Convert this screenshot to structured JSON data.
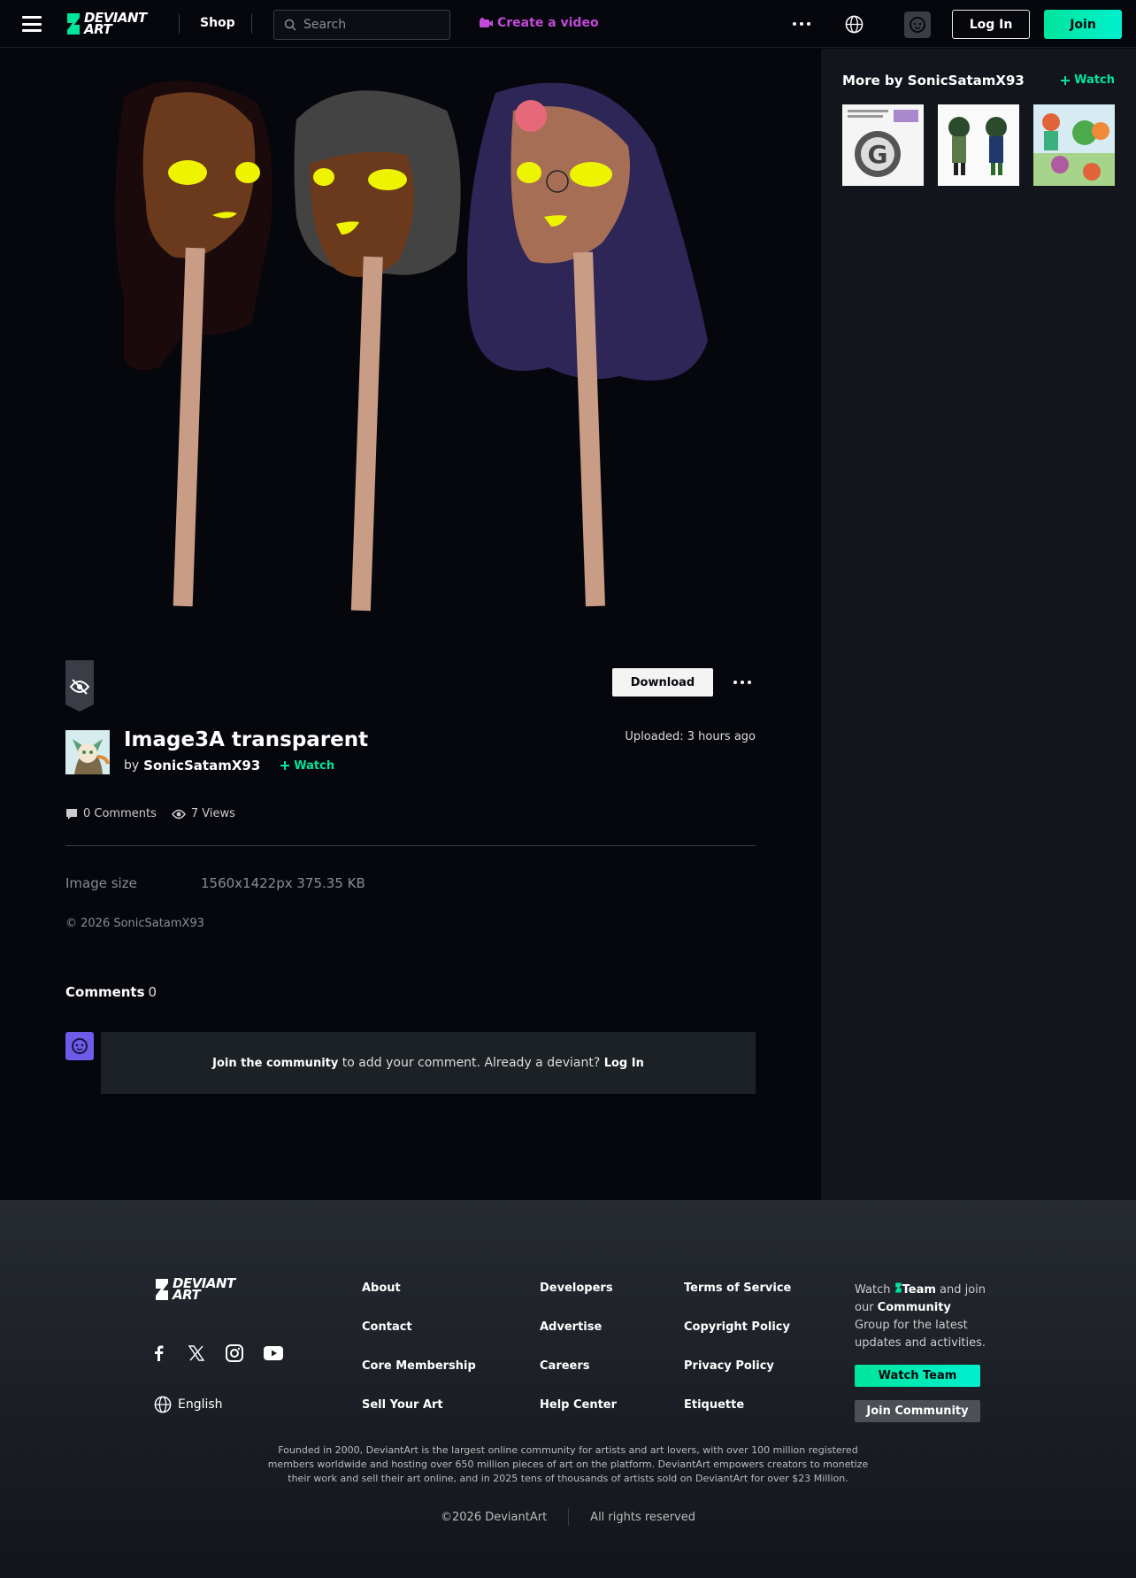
{
  "header": {
    "logo_text_line1": "DEVIANT",
    "logo_text_line2": "ART",
    "shop_label": "Shop",
    "search_placeholder": "Search",
    "create_video_label": "Create a video",
    "login_label": "Log In",
    "join_label": "Join"
  },
  "sidebar": {
    "more_by_label": "More by SonicSatamX93",
    "watch_label": "Watch",
    "thumbnails": [
      "thumbnail-1",
      "thumbnail-2",
      "thumbnail-3"
    ]
  },
  "deviation": {
    "title": "Image3A transparent",
    "by_label": "by",
    "author": "SonicSatamX93",
    "watch_label": "Watch",
    "uploaded": "Uploaded: 3 hours ago",
    "download_label": "Download",
    "comments_count": "0 Comments",
    "views_count": "7 Views",
    "image_size_label": "Image size",
    "image_size_value": "1560x1422px 375.35 KB",
    "copyright": "© 2026 SonicSatamX93"
  },
  "comments": {
    "heading": "Comments",
    "count": "0",
    "join_community": "Join the community",
    "middle_text": " to add your comment. Already a deviant? ",
    "login_label": "Log In"
  },
  "footer": {
    "language": "English",
    "links": {
      "about": "About",
      "contact": "Contact",
      "core_membership": "Core Membership",
      "sell_your_art": "Sell Your Art",
      "developers": "Developers",
      "advertise": "Advertise",
      "careers": "Careers",
      "help_center": "Help Center",
      "terms": "Terms of Service",
      "copyright_policy": "Copyright Policy",
      "privacy": "Privacy Policy",
      "etiquette": "Etiquette"
    },
    "watch_text_1": "Watch ",
    "watch_text_team": "Team",
    "watch_text_2": " and join our ",
    "watch_text_community": "Community",
    "watch_text_3": " Group for the latest updates and activities.",
    "watch_team_button": "Watch Team",
    "join_community_button": "Join Community",
    "about_text": "Founded in 2000, DeviantArt is the largest online community for artists and art lovers, with over 100 million registered members worldwide and hosting over 650 million pieces of art on the platform. DeviantArt empowers creators to monetize their work and sell their art online, and in 2025 tens of thousands of artists sold on DeviantArt for over $23 Million.",
    "copyright": "©2026 DeviantArt",
    "rights": "All rights reserved"
  },
  "colors": {
    "accent": "#00e59b",
    "create_video": "#c34ad9",
    "background": "#06070d",
    "panel": "#12151c"
  }
}
